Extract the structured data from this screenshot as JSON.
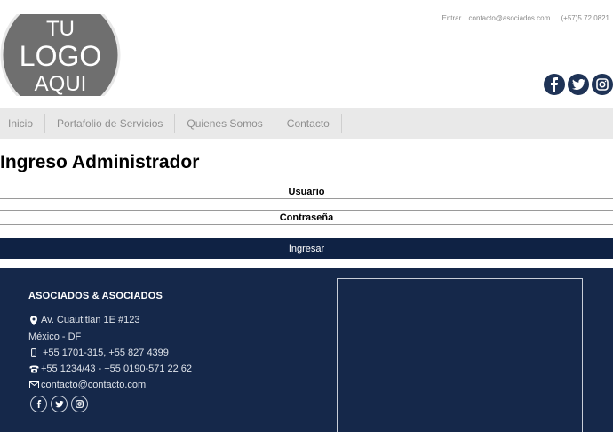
{
  "header": {
    "logo": {
      "line1": "TU",
      "line2": "LOGO",
      "line3": "AQUI"
    },
    "top_links": {
      "login": "Entrar",
      "email": "contacto@asociados.com",
      "phone": "(+57)5 72 0821"
    },
    "social_icons": [
      "facebook-icon",
      "twitter-icon",
      "instagram-icon"
    ]
  },
  "nav": {
    "items": [
      "Inicio",
      "Portafolio de Servicios",
      "Quienes Somos",
      "Contacto"
    ]
  },
  "main": {
    "title": "Ingreso Administrador",
    "username_label": "Usuario",
    "username_value": "",
    "password_label": "Contraseña",
    "password_value": "",
    "submit_label": "Ingresar"
  },
  "footer": {
    "company": "ASOCIADOS & ASOCIADOS",
    "address_line1": "Av. Cuautitlan 1E #123",
    "address_line2": "México - DF",
    "mobile": "+55 1701-315, +55 827 4399",
    "phone": "+55 1234/43 - +55 0190-571 22 62",
    "email": "contacto@contacto.com",
    "social_icons": [
      "facebook-icon",
      "twitter-icon",
      "instagram-icon"
    ]
  },
  "colors": {
    "navy": "#15284a",
    "button": "#0f2244",
    "nav_bg": "#e9e9e9",
    "logo_gray": "#6f6f6f"
  }
}
